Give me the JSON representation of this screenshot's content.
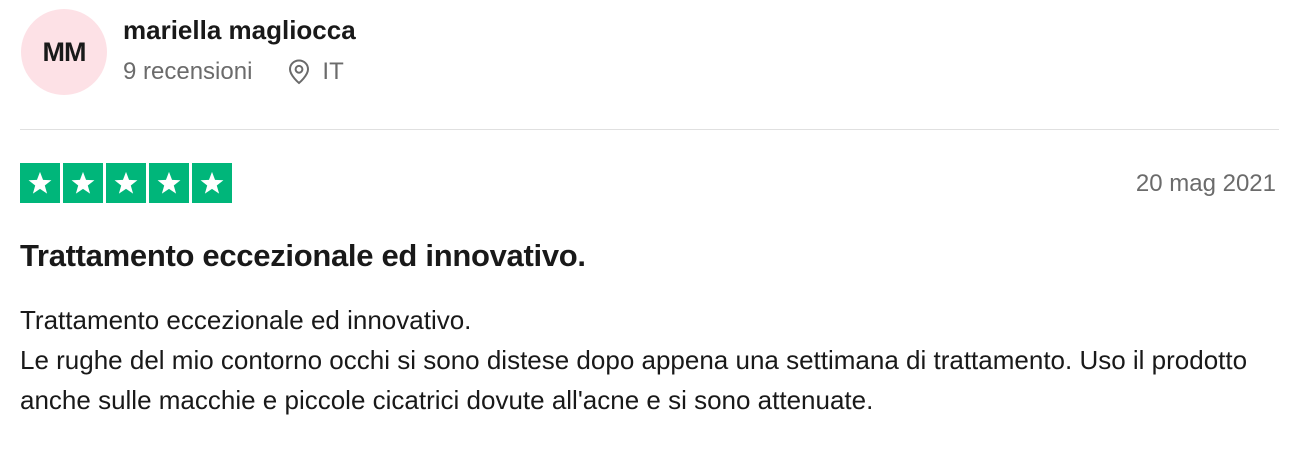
{
  "reviewer": {
    "initials": "MM",
    "name": "mariella magliocca",
    "reviews_count": "9 recensioni",
    "location_icon": "location-pin-icon",
    "country": "IT",
    "avatar_color": "#fde1e6"
  },
  "review": {
    "rating": 5,
    "rating_max": 5,
    "star_color": "#00b67a",
    "date": "20 mag 2021",
    "title": "Trattamento eccezionale ed innovativo.",
    "body_line1": "Trattamento eccezionale ed innovativo.",
    "body_line2": "Le rughe del mio contorno occhi si sono distese dopo appena una settimana di trattamento. Uso il prodotto anche sulle macchie e piccole cicatrici dovute all'acne e si sono attenuate."
  }
}
